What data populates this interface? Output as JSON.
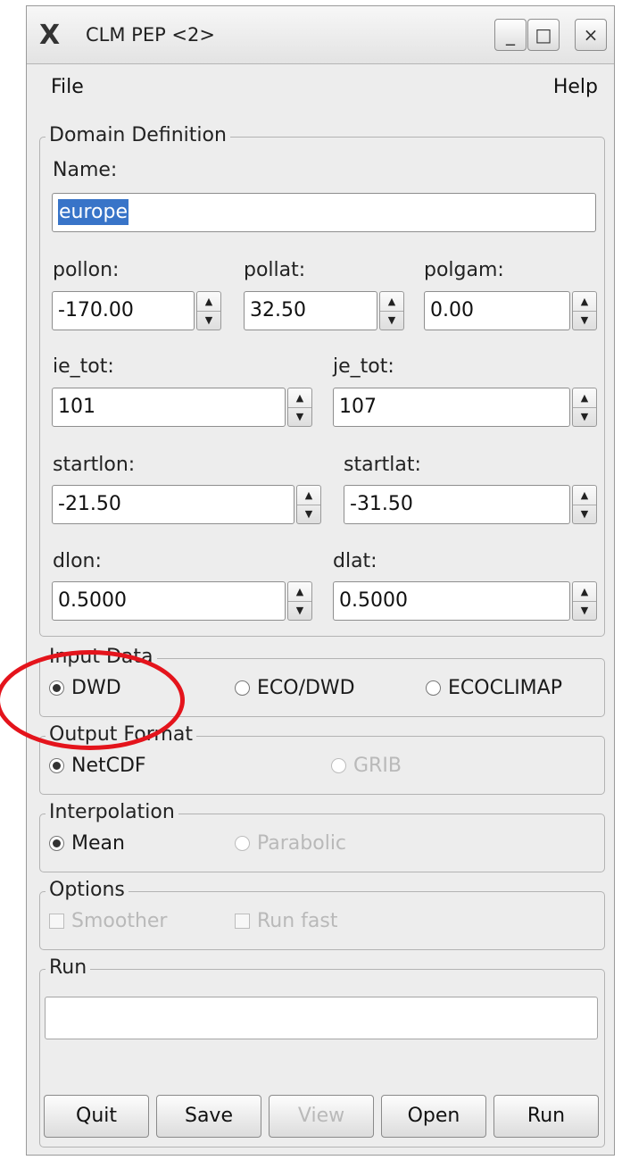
{
  "window": {
    "title": "CLM PEP <2>",
    "app_icon": "X",
    "minimize_symbol": "_",
    "maximize_symbol": "□",
    "close_symbol": "×"
  },
  "menu": {
    "file": "File",
    "help": "Help"
  },
  "domain": {
    "legend": "Domain Definition",
    "name_label": "Name:",
    "name_value": "europe",
    "pollon_label": "pollon:",
    "pollon_value": "-170.00",
    "pollat_label": "pollat:",
    "pollat_value": "32.50",
    "polgam_label": "polgam:",
    "polgam_value": "0.00",
    "ie_tot_label": "ie_tot:",
    "ie_tot_value": "101",
    "je_tot_label": "je_tot:",
    "je_tot_value": "107",
    "startlon_label": "startlon:",
    "startlon_value": "-21.50",
    "startlat_label": "startlat:",
    "startlat_value": "-31.50",
    "dlon_label": "dlon:",
    "dlon_value": "0.5000",
    "dlat_label": "dlat:",
    "dlat_value": "0.5000"
  },
  "input_data": {
    "legend": "Input Data",
    "options": [
      "DWD",
      "ECO/DWD",
      "ECOCLIMAP"
    ],
    "selected": "DWD"
  },
  "output_format": {
    "legend": "Output Format",
    "options": [
      "NetCDF",
      "GRIB"
    ],
    "selected": "NetCDF"
  },
  "interpolation": {
    "legend": "Interpolation",
    "options": [
      "Mean",
      "Parabolic"
    ],
    "selected": "Mean"
  },
  "options_group": {
    "legend": "Options",
    "smoother": "Smoother",
    "run_fast": "Run fast"
  },
  "run": {
    "legend": "Run",
    "progress_text": ""
  },
  "buttons": {
    "quit": "Quit",
    "save": "Save",
    "view": "View",
    "open": "Open",
    "run": "Run"
  },
  "colors": {
    "annotation": "#e4141c",
    "selection": "#3874c8"
  }
}
